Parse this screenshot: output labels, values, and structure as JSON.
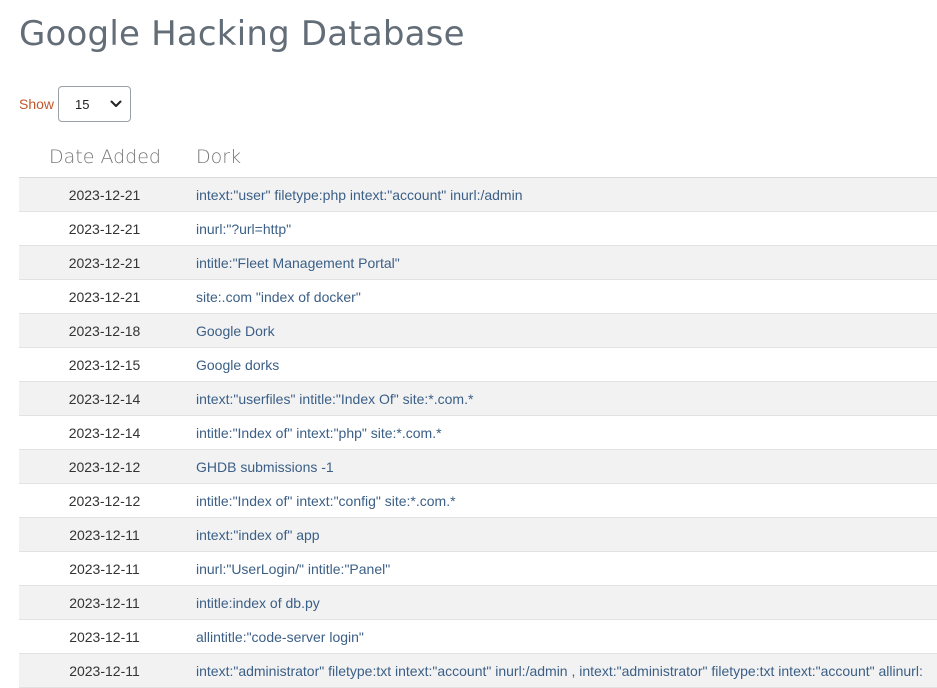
{
  "page": {
    "title": "Google Hacking Database"
  },
  "show": {
    "label": "Show",
    "value": "15"
  },
  "table": {
    "headers": {
      "date": "Date Added",
      "dork": "Dork"
    },
    "rows": [
      {
        "date": "2023-12-21",
        "dork": "intext:\"user\" filetype:php intext:\"account\" inurl:/admin"
      },
      {
        "date": "2023-12-21",
        "dork": "inurl:\"?url=http\""
      },
      {
        "date": "2023-12-21",
        "dork": "intitle:\"Fleet Management Portal\""
      },
      {
        "date": "2023-12-21",
        "dork": "site:.com \"index of docker\""
      },
      {
        "date": "2023-12-18",
        "dork": "Google Dork"
      },
      {
        "date": "2023-12-15",
        "dork": "Google dorks"
      },
      {
        "date": "2023-12-14",
        "dork": "intext:\"userfiles\" intitle:\"Index Of\" site:*.com.*"
      },
      {
        "date": "2023-12-14",
        "dork": "intitle:\"Index of\" intext:\"php\" site:*.com.*"
      },
      {
        "date": "2023-12-12",
        "dork": "GHDB submissions -1"
      },
      {
        "date": "2023-12-12",
        "dork": "intitle:\"Index of\" intext:\"config\" site:*.com.*"
      },
      {
        "date": "2023-12-11",
        "dork": "intext:\"index of\" app"
      },
      {
        "date": "2023-12-11",
        "dork": "inurl:\"UserLogin/\" intitle:\"Panel\""
      },
      {
        "date": "2023-12-11",
        "dork": "intitle:index of db.py"
      },
      {
        "date": "2023-12-11",
        "dork": "allintitle:\"code-server login\""
      },
      {
        "date": "2023-12-11",
        "dork": "intext:\"administrator\" filetype:txt intext:\"account\" inurl:/admin , intext:\"administrator\" filetype:txt intext:\"account\" allinurl:"
      }
    ]
  },
  "colors": {
    "title": "#636d78",
    "show_label": "#c0582d",
    "link": "#3b5f86",
    "stripe": "#f2f2f2"
  },
  "icons": {
    "select": "chevron-down-icon"
  }
}
